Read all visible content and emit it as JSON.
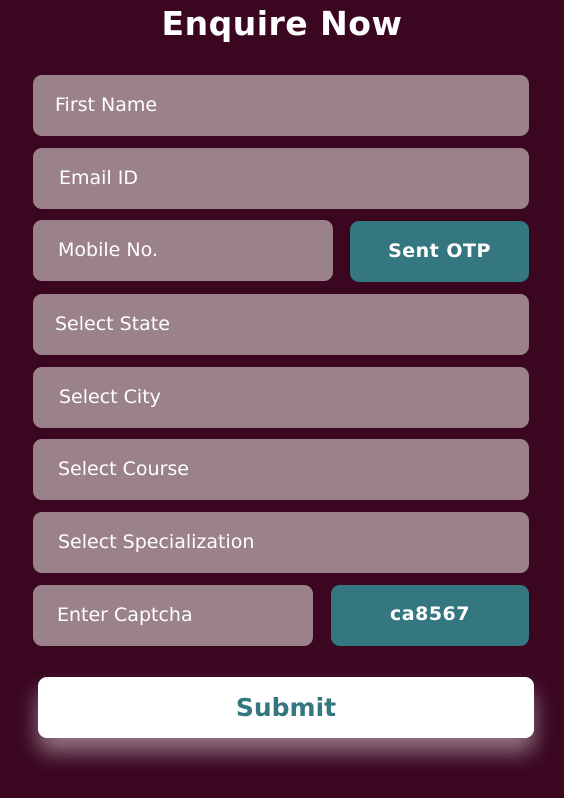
{
  "form": {
    "title": "Enquire Now",
    "first_name_placeholder": "First Name",
    "email_placeholder": "Email ID",
    "mobile_placeholder": "Mobile No.",
    "otp_button_label": "Sent OTP",
    "state_placeholder": "Select State",
    "city_placeholder": "Select City",
    "course_placeholder": "Select Course",
    "specialization_placeholder": "Select Specialization",
    "captcha_placeholder": "Enter Captcha",
    "captcha_code": "ca8567",
    "submit_label": "Submit"
  },
  "colors": {
    "background": "#3a0620",
    "field": "#9a818a",
    "accent": "#347780",
    "submit_background": "#ffffff"
  }
}
